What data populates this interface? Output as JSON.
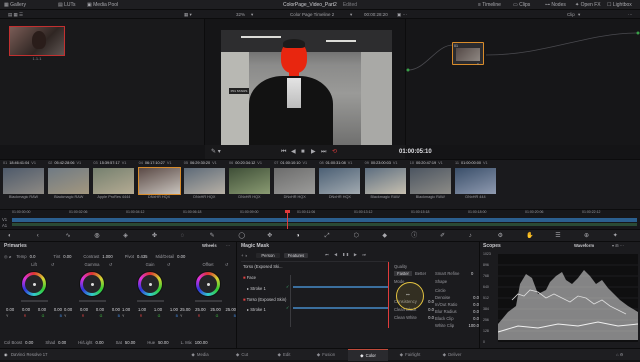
{
  "topbar": {
    "gallery": "Gallery",
    "luts": "LUTs",
    "media_pool": "Media Pool",
    "project_title": "ColorPage_Video_Part2",
    "edited": "Edited",
    "timeline": "Timeline",
    "clips": "Clips",
    "nodes": "Nodes",
    "open_fx": "Open FX",
    "lightbox": "Lightbox"
  },
  "subbar": {
    "zoom": "32%",
    "timeline_name": "Color Page Timeline 2",
    "timecode": "00:00:28:20",
    "clip_mode": "Clip"
  },
  "gallery": {
    "still_label": "1.1.1"
  },
  "viewer": {
    "timecode": "01:00:05:10",
    "sign": "P01 STAIRS"
  },
  "node": {
    "number": "01"
  },
  "clips": [
    {
      "num": "01",
      "tc": "18:46:41:04",
      "track": "V1",
      "label": "Blackmagic RAW",
      "colors": [
        "#4e5a6b",
        "#8e8a84"
      ]
    },
    {
      "num": "02",
      "tc": "05:42:28:06",
      "track": "V1",
      "label": "Blackmagic RAW",
      "colors": [
        "#6f7a84",
        "#a3977f"
      ]
    },
    {
      "num": "03",
      "tc": "15:39:57:17",
      "track": "V1",
      "label": "Apple ProRes 4444",
      "colors": [
        "#75806f",
        "#b5ab93"
      ]
    },
    {
      "num": "04",
      "tc": "06:17:10:27",
      "track": "V1",
      "label": "DNxHR HQX",
      "colors": [
        "#5b4a46",
        "#c9c4be"
      ]
    },
    {
      "num": "05",
      "tc": "06:29:30:20",
      "track": "V1",
      "label": "DNxHR HQX",
      "colors": [
        "#5d6a78",
        "#b8b1a6"
      ]
    },
    {
      "num": "06",
      "tc": "00:20:34:12",
      "track": "V1",
      "label": "DNxHR HQX",
      "colors": [
        "#3f4f38",
        "#8a9b72"
      ]
    },
    {
      "num": "07",
      "tc": "01:00:10:10",
      "track": "V1",
      "label": "DNxHR HQX",
      "colors": [
        "#6c6c6c",
        "#9c9c9a"
      ]
    },
    {
      "num": "08",
      "tc": "01:00:31:08",
      "track": "V1",
      "label": "DNxHR HQX",
      "colors": [
        "#4c6075",
        "#a2aab0"
      ]
    },
    {
      "num": "09",
      "tc": "00:23:00:03",
      "track": "V1",
      "label": "Blackmagic RAW",
      "colors": [
        "#5d6e80",
        "#c7c0b0"
      ]
    },
    {
      "num": "10",
      "tc": "00:20:47:19",
      "track": "V1",
      "label": "Blackmagic RAW",
      "colors": [
        "#4c5561",
        "#8d8c87"
      ]
    },
    {
      "num": "11",
      "tc": "01:00:00:00",
      "track": "V1",
      "label": "DNxHR 444",
      "colors": [
        "#3a4f6a",
        "#8f9ab0"
      ]
    }
  ],
  "timeline_ruler": [
    "01:00:00:00",
    "01:00:02:06",
    "01:00:04:12",
    "01:00:06:18",
    "01:00:09:00",
    "01:00:11:06",
    "01:00:13:12",
    "01:00:15:18",
    "01:00:18:00",
    "01:00:20:06",
    "01:00:22:12"
  ],
  "timeline_tracks": [
    "V1",
    "A1"
  ],
  "primaries": {
    "title": "Primaries",
    "mode": "Wheels",
    "temp_label": "Temp",
    "temp": "0.0",
    "tint_label": "Tint",
    "tint": "0.00",
    "contrast_label": "Contrast",
    "contrast": "1.000",
    "pivot_label": "Pivot",
    "pivot": "0.435",
    "middetail_label": "Mid/Detail",
    "middetail": "0.00",
    "wheels": [
      {
        "name": "Lift",
        "values": [
          "0.00",
          "0.00",
          "0.00",
          "0.00"
        ],
        "master": "0.00"
      },
      {
        "name": "Gamma",
        "values": [
          "0.00",
          "0.00",
          "0.00",
          "0.00"
        ],
        "master": "0.00"
      },
      {
        "name": "Gain",
        "values": [
          "1.00",
          "1.00",
          "1.00",
          "1.00"
        ],
        "master": "1.00"
      },
      {
        "name": "Offset",
        "values": [
          "25.00",
          "25.00",
          "25.00",
          "25.00"
        ],
        "master": "25.00"
      }
    ],
    "bottom": [
      {
        "label": "Col Boost",
        "value": "0.00"
      },
      {
        "label": "Shad",
        "value": "0.00"
      },
      {
        "label": "Hi/Light",
        "value": "0.00"
      },
      {
        "label": "Sat",
        "value": "50.00"
      },
      {
        "label": "Hue",
        "value": "50.00"
      },
      {
        "label": "L. Mix",
        "value": "100.00"
      }
    ]
  },
  "magic_mask": {
    "title": "Magic Mask",
    "tab_person": "Person",
    "tab_features": "Features",
    "tracks": [
      {
        "label": "Torso (Exposed Ski..."
      },
      {
        "label": "Face"
      },
      {
        "label": "Stroke 1"
      },
      {
        "label": "Torso (Exposed Skin)"
      },
      {
        "label": "Stroke 1"
      }
    ],
    "quality_label": "Quality",
    "faster": "Faster",
    "better": "Better",
    "smart_refine": "Smart Refine",
    "smart_refine_val": "0",
    "mode_label": "Mode",
    "mode_val": "Shape",
    "left_params": [
      {
        "label": "Consistency",
        "value": "0.0"
      },
      {
        "label": "Clean Black",
        "value": "0.0"
      },
      {
        "label": "Clean White",
        "value": "0.0"
      }
    ],
    "right_params": [
      {
        "label": "Circle",
        "value": ""
      },
      {
        "label": "Denoise",
        "value": "0.0"
      },
      {
        "label": "In/Out Ratio",
        "value": "0.0"
      },
      {
        "label": "Blur Radius",
        "value": "0.0"
      },
      {
        "label": "Black Clip",
        "value": "0.0"
      },
      {
        "label": "White Clip",
        "value": "100.0"
      }
    ]
  },
  "scopes": {
    "title": "Scopes",
    "mode": "Waveform",
    "scale": [
      "1023",
      "896",
      "768",
      "640",
      "512",
      "384",
      "256",
      "128",
      "0"
    ]
  },
  "bottombar": {
    "app_name": "DaVinci Resolve 17",
    "pages": [
      "Media",
      "Cut",
      "Edit",
      "Fusion",
      "Color",
      "Fairlight",
      "Deliver"
    ],
    "active_page": "Color"
  }
}
